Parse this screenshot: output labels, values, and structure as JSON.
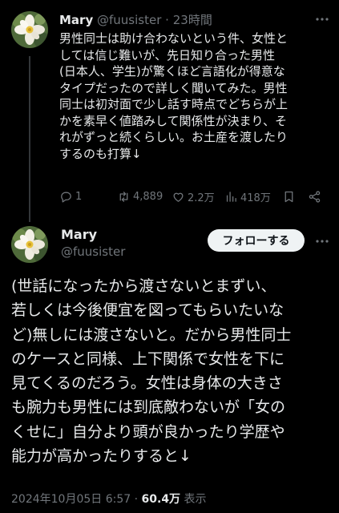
{
  "tweet1": {
    "name": "Mary",
    "handle": "@fuusister",
    "separator": "·",
    "time": "23時間",
    "lines": [
      "男性同士は助け合わないという件、女性と",
      "しては信じ難いが、先日知り合った男性",
      "(日本人、学生)が驚くほど言語化が得意な",
      "タイプだったので詳しく聞いてみた。男性",
      "同士は初対面で少し話す時点でどちらが上",
      "かを素早く値踏みして関係性が決まり、そ",
      "れがずっと続くらしい。お土産を渡したり",
      "するのも打算↓"
    ],
    "replies": "1",
    "retweets": "4,889",
    "likes": "2.2万",
    "views": "418万"
  },
  "tweet2": {
    "name": "Mary",
    "handle": "@fuusister",
    "follow_label": "フォローする",
    "lines": [
      "(世話になったから渡さないとまずい、",
      "若しくは今後便宜を図ってもらいたいな",
      "ど)無しには渡さないと。だから男性同士",
      "のケースと同様、上下関係で女性を下に",
      "見てくるのだろう。女性は身体の大きさ",
      "も腕力も男性には到底敵わないが「女の",
      "くせに」自分より頭が良かったり学歴や",
      "能力が高かったりすると↓"
    ],
    "date": "2024年10月05日 6:57",
    "separator": "·",
    "views": "60.4万",
    "views_label": "表示"
  },
  "colors": {
    "background": "#000000",
    "text": "#e7e9ea",
    "muted": "#71767b",
    "button_bg": "#eff3f4",
    "button_text": "#0f1419"
  },
  "icons": {
    "reply": "reply-icon",
    "retweet": "retweet-icon",
    "like": "heart-icon",
    "views": "bar-chart-icon",
    "bookmark": "bookmark-icon",
    "share": "share-icon",
    "more": "more-icon"
  }
}
